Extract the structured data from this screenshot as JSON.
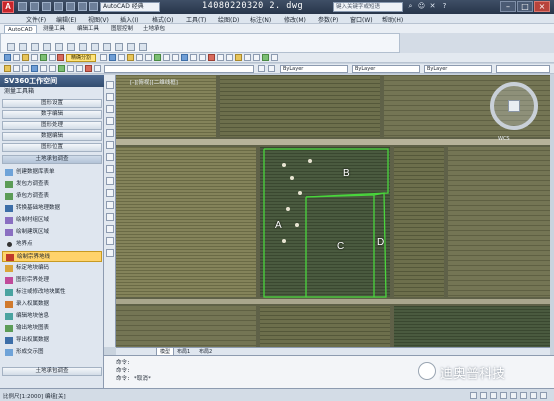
{
  "app": {
    "logo_letter": "A",
    "workspace": "AutoCAD 经典",
    "title": "14080220320 2. dwg",
    "search_placeholder": "键入关键字或短语"
  },
  "menu": [
    "文件(F)",
    "编辑(E)",
    "视图(V)",
    "插入(I)",
    "格式(O)",
    "工具(T)",
    "绘图(D)",
    "标注(N)",
    "修改(M)",
    "参数(P)",
    "窗口(W)",
    "帮助(H)"
  ],
  "tabs": [
    "AutoCAD",
    "测量工具",
    "编辑工具",
    "图层控制",
    "土地承包"
  ],
  "toolbar": {
    "highlight_label": "精确分割",
    "layer_1": "ByLayer",
    "layer_2": "ByLayer",
    "layer_3": "ByLayer"
  },
  "palette": {
    "title": "SV360工作空间",
    "subtitle": "测量工具箱",
    "buttons": [
      "图形设置",
      "数字编辑",
      "图形处理",
      "数据编辑",
      "图形位置"
    ],
    "section": "土地承包调查",
    "items": [
      {
        "label": "创建数据库表单",
        "icon": "db",
        "active": false
      },
      {
        "label": "发包方调查表",
        "icon": "table",
        "active": false
      },
      {
        "label": "承包方调查表",
        "icon": "table",
        "active": false
      },
      {
        "label": "转换基础地理数据",
        "icon": "convert",
        "active": false
      },
      {
        "label": "绘制村组区域",
        "icon": "polygon",
        "active": false
      },
      {
        "label": "绘制建筑区域",
        "icon": "polygon",
        "active": false
      },
      {
        "label": "地界点",
        "icon": "point",
        "active": false
      },
      {
        "label": "绘制宗界地线",
        "icon": "pen",
        "active": true
      },
      {
        "label": "标定地块编码",
        "icon": "tag",
        "active": false
      },
      {
        "label": "图形宗界处理",
        "icon": "grid",
        "active": false
      },
      {
        "label": "标注或修改地块属性",
        "icon": "edit",
        "active": false
      },
      {
        "label": "录入权属数据",
        "icon": "people",
        "active": false
      },
      {
        "label": "编辑地块信息",
        "icon": "edit",
        "active": false
      },
      {
        "label": "输出地块图表",
        "icon": "table",
        "active": false
      },
      {
        "label": "导出权属数据",
        "icon": "export",
        "active": false
      },
      {
        "label": "形成交示图",
        "icon": "map",
        "active": false
      }
    ],
    "footer": "土地承包调查"
  },
  "canvas": {
    "viewport_label": "[-][俯视][二维线框]",
    "compass_label": "WCS",
    "parcels": [
      "A",
      "B",
      "C",
      "D"
    ]
  },
  "layout_tabs": [
    "模型",
    "布局1",
    "布局2"
  ],
  "command": {
    "lines": [
      "命令:",
      "命令:",
      "命令: *取消*"
    ]
  },
  "status": {
    "text": "比例尺[1:2000] 编组[关]"
  },
  "watermark": {
    "text": "迪奥普科技"
  },
  "colors": {
    "parcel_boundary": "#49d63c",
    "active_item": "#ffd36b",
    "palette_header": "#4d6a92"
  }
}
